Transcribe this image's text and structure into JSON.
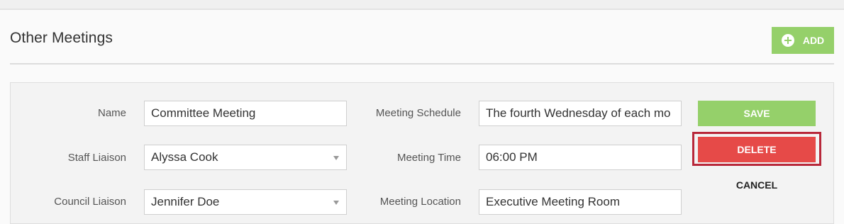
{
  "section": {
    "title": "Other Meetings",
    "add_label": "ADD"
  },
  "form": {
    "name": {
      "label": "Name",
      "value": "Committee Meeting"
    },
    "staff_liaison": {
      "label": "Staff Liaison",
      "value": "Alyssa Cook"
    },
    "council_liaison": {
      "label": "Council Liaison",
      "value": "Jennifer Doe"
    },
    "meeting_schedule": {
      "label": "Meeting Schedule",
      "value": "The fourth Wednesday of each mo"
    },
    "meeting_time": {
      "label": "Meeting Time",
      "value": "06:00 PM"
    },
    "meeting_location": {
      "label": "Meeting Location",
      "value": "Executive Meeting Room"
    }
  },
  "actions": {
    "save_label": "SAVE",
    "delete_label": "DELETE",
    "cancel_label": "CANCEL"
  },
  "colors": {
    "add_button": "#95d06a",
    "save_button": "#95d06a",
    "delete_button": "#e64a48",
    "delete_highlight": "#b8283a"
  },
  "icons": {
    "add": "plus-circle-icon",
    "select": "chevron-down-icon"
  }
}
